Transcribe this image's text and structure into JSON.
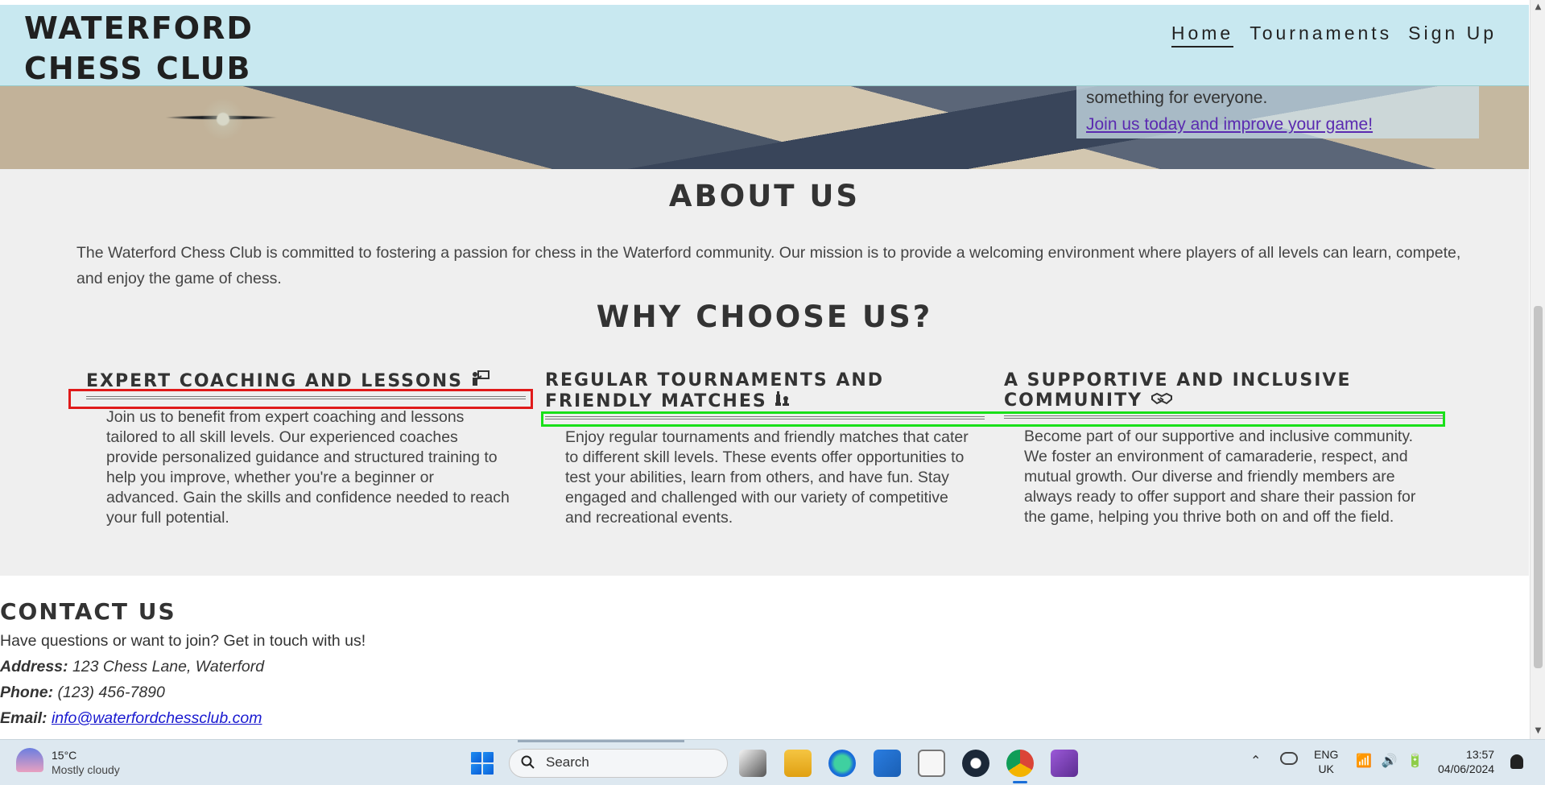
{
  "site": {
    "logo_line1": "WATERFORD",
    "logo_line2": "CHESS CLUB",
    "nav": [
      {
        "label": "Home",
        "active": true
      },
      {
        "label": "Tournaments",
        "active": false
      },
      {
        "label": "Sign Up",
        "active": false
      }
    ]
  },
  "hero": {
    "text": "something for everyone.",
    "link": "Join us today and improve your game!"
  },
  "about": {
    "title": "ABOUT US",
    "text": "The Waterford Chess Club is committed to fostering a passion for chess in the Waterford community. Our mission is to provide a welcoming environment where players of all levels can learn, compete, and enjoy the game of chess."
  },
  "why": {
    "title": "WHY CHOOSE US?",
    "features": [
      {
        "title": "EXPERT COACHING AND LESSONS",
        "icon": "person-teaching-icon",
        "text": "Join us to benefit from expert coaching and lessons tailored to all skill levels. Our experienced coaches provide personalized guidance and structured training to help you improve, whether you're a beginner or advanced. Gain the skills and confidence needed to reach your full potential."
      },
      {
        "title": "REGULAR TOURNAMENTS AND FRIENDLY MATCHES",
        "icon": "chess-pieces-icon",
        "text": "Enjoy regular tournaments and friendly matches that cater to different skill levels. These events offer opportunities to test your abilities, learn from others, and have fun. Stay engaged and challenged with our variety of competitive and recreational events."
      },
      {
        "title": "A SUPPORTIVE AND INCLUSIVE COMMUNITY",
        "icon": "handshake-icon",
        "text": "Become part of our supportive and inclusive community. We foster an environment of camaraderie, respect, and mutual growth. Our diverse and friendly members are always ready to offer support and share their passion for the game, helping you thrive both on and off the field."
      }
    ]
  },
  "contact": {
    "title": "CONTACT US",
    "intro": "Have questions or want to join? Get in touch with us!",
    "address_label": "Address:",
    "address": "123 Chess Lane, Waterford",
    "phone_label": "Phone:",
    "phone": "(123) 456-7890",
    "email_label": "Email:",
    "email": "info@waterfordchessclub.com"
  },
  "taskbar": {
    "weather_temp": "15°C",
    "weather_condition": "Mostly cloudy",
    "search_label": "Search",
    "lang_line1": "ENG",
    "lang_line2": "UK",
    "time": "13:57",
    "date": "04/06/2024"
  },
  "annotations": {
    "red_color": "#e01a1a",
    "green_color": "#19e019"
  }
}
